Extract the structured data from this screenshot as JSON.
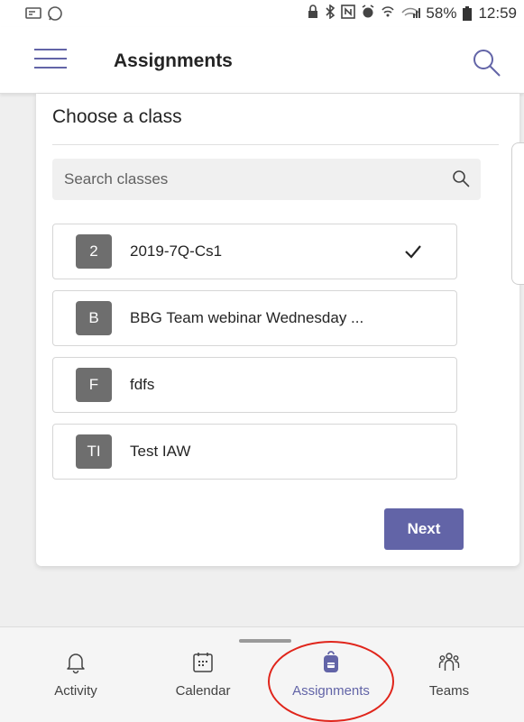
{
  "status_bar": {
    "battery": "58%",
    "time": "12:59",
    "left_icons": [
      "cast-icon",
      "whatsapp-icon"
    ],
    "right_icons": [
      "lock-icon",
      "bluetooth-icon",
      "nfc-icon",
      "alarm-icon",
      "signal-icon",
      "wifi-icon",
      "battery-icon"
    ]
  },
  "header": {
    "title": "Assignments"
  },
  "class_picker": {
    "title": "Choose a class",
    "search_placeholder": "Search classes",
    "classes": [
      {
        "initials": "2",
        "name": "2019-7Q-Cs1",
        "selected": true
      },
      {
        "initials": "B",
        "name": "BBG Team webinar Wednesday ...",
        "selected": false
      },
      {
        "initials": "F",
        "name": "fdfs",
        "selected": false
      },
      {
        "initials": "TI",
        "name": "Test IAW",
        "selected": false
      }
    ],
    "next_label": "Next"
  },
  "bottom_nav": {
    "items": [
      {
        "label": "Activity",
        "icon": "bell-icon",
        "active": false
      },
      {
        "label": "Calendar",
        "icon": "calendar-icon",
        "active": false
      },
      {
        "label": "Assignments",
        "icon": "backpack-icon",
        "active": true
      },
      {
        "label": "Teams",
        "icon": "teams-icon",
        "active": false
      }
    ]
  },
  "colors": {
    "accent": "#6264a7",
    "avatar": "#6e6e6e",
    "highlight": "#e0251b"
  }
}
